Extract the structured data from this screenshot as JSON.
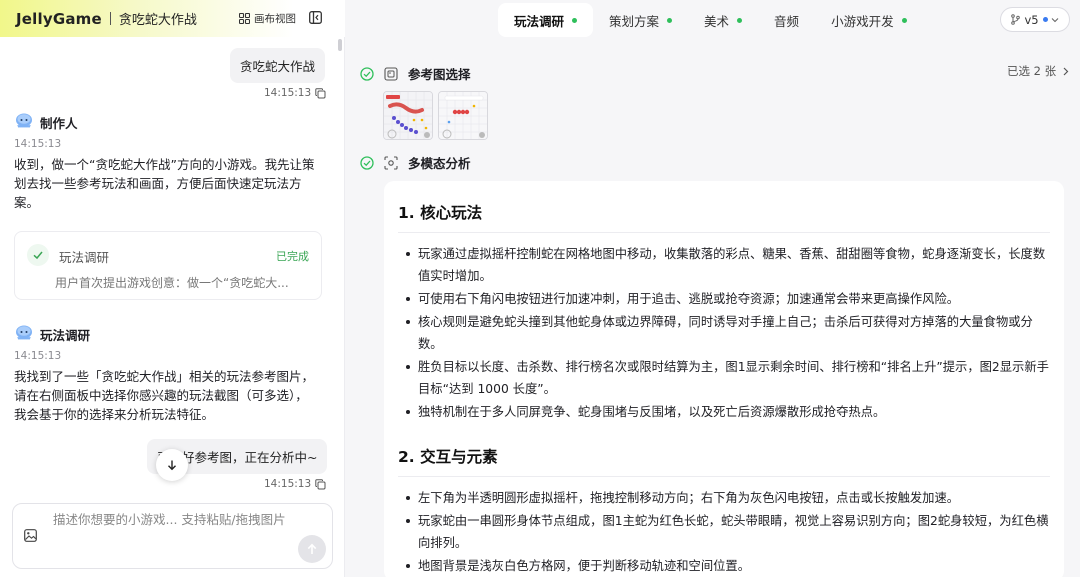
{
  "header": {
    "logo": "JellyGame",
    "project_title": "贪吃蛇大作战",
    "canvas_view_label": "画布视图"
  },
  "chat": {
    "user_message_1": "贪吃蛇大作战",
    "user_message_1_time": "14:15:13",
    "agent_1_name": "制作人",
    "agent_1_time": "14:15:13",
    "agent_1_text": "收到，做一个“贪吃蛇大作战”方向的小游戏。我先让策划去找一些参考玩法和画面，方便后面快速定玩法方案。",
    "task_card": {
      "title": "玩法调研",
      "status": "已完成",
      "subtitle": "用户首次提出游戏创意：做一个“贪吃蛇大..."
    },
    "agent_2_name": "玩法调研",
    "agent_2_time": "14:15:13",
    "agent_2_text": "我找到了一些「贪吃蛇大作战」相关的玩法参考图片，请在右侧面板中选择你感兴趣的玩法截图（可多选），我会基于你的选择来分析玩法特征。",
    "user_message_2": "已选好参考图，正在分析中~",
    "user_message_2_time": "14:15:13",
    "input_placeholder": "描述你想要的小游戏... 支持粘贴/拖拽图片"
  },
  "tabs": [
    {
      "label": "玩法调研",
      "active": true,
      "has_dot": true
    },
    {
      "label": "策划方案",
      "active": false,
      "has_dot": true
    },
    {
      "label": "美术",
      "active": false,
      "has_dot": true
    },
    {
      "label": "音频",
      "active": false,
      "has_dot": false
    },
    {
      "label": "小游戏开发",
      "active": false,
      "has_dot": true
    }
  ],
  "version_label": "v5",
  "steps": {
    "reference_label": "参考图选择",
    "selected_count": "已选 2 张",
    "analysis_label": "多模态分析"
  },
  "analysis": {
    "section_1_title": "1. 核心玩法",
    "section_1_items": [
      "玩家通过虚拟摇杆控制蛇在网格地图中移动，收集散落的彩点、糖果、香蕉、甜甜圈等食物，蛇身逐渐变长，长度数值实时增加。",
      "可使用右下角闪电按钮进行加速冲刺，用于追击、逃脱或抢夺资源；加速通常会带来更高操作风险。",
      "核心规则是避免蛇头撞到其他蛇身体或边界障碍，同时诱导对手撞上自己；击杀后可获得对方掉落的大量食物或分数。",
      "胜负目标以长度、击杀数、排行榜名次或限时结算为主，图1显示剩余时间、排行榜和“排名上升”提示，图2显示新手目标“达到 1000 长度”。",
      "独特机制在于多人同屏竞争、蛇身围堵与反围堵，以及死亡后资源爆散形成抢夺热点。"
    ],
    "section_2_title": "2. 交互与元素",
    "section_2_items": [
      "左下角为半透明圆形虚拟摇杆，拖拽控制移动方向；右下角为灰色闪电按钮，点击或长按触发加速。",
      "玩家蛇由一串圆形身体节点组成，图1主蛇为红色长蛇，蛇头带眼睛，视觉上容易识别方向；图2蛇身较短，为红色横向排列。",
      "地图背景是浅灰白色方格网，便于判断移动轨迹和空间位置。"
    ]
  },
  "colors": {
    "accent_green": "#2fbf5b",
    "version_dot": "#3a7bf0",
    "header_yellow": "#f1f78a"
  }
}
